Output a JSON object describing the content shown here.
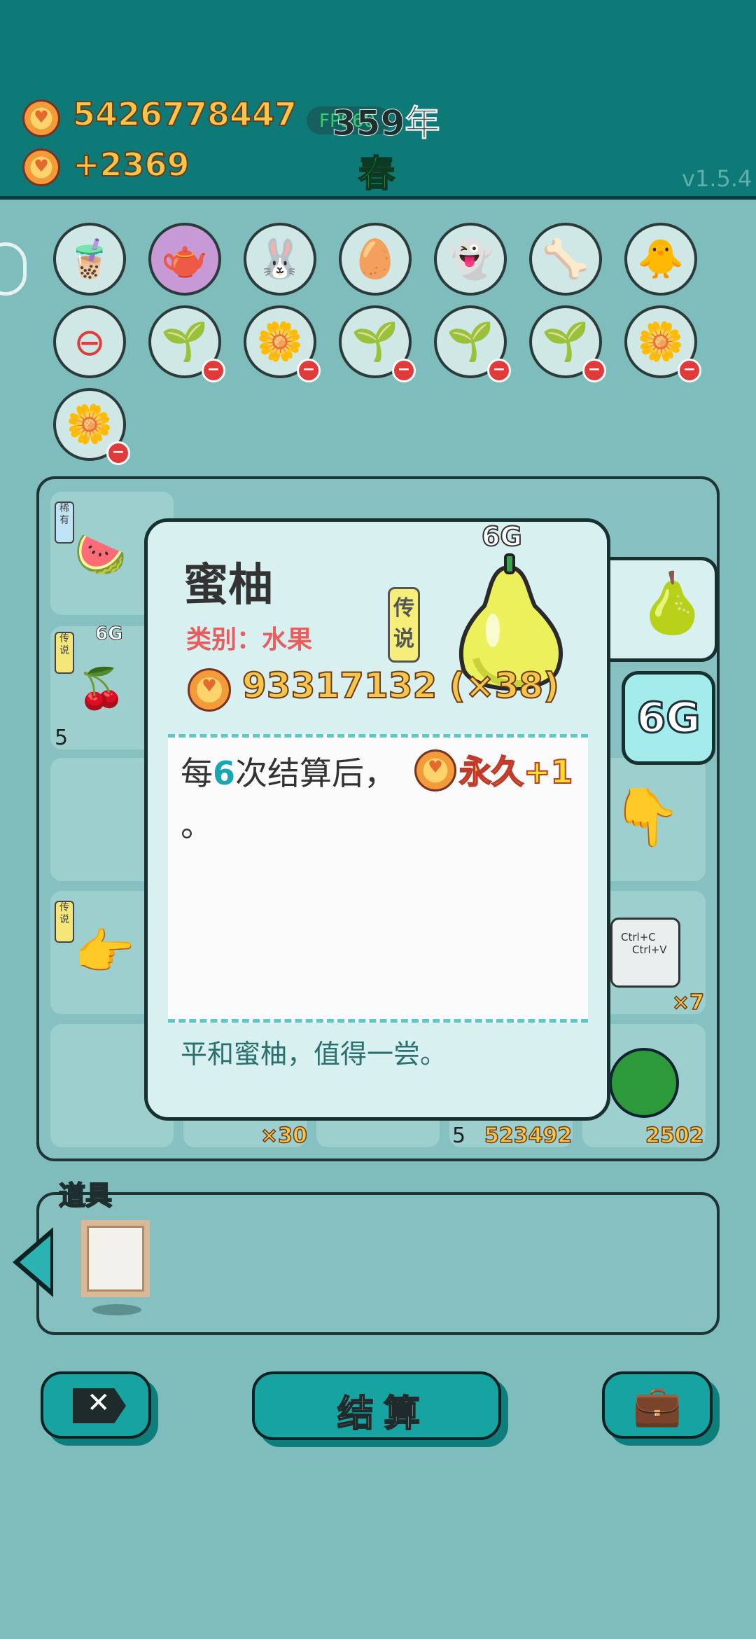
{
  "header": {
    "total_coins": "5426778447",
    "income": "+2369",
    "fps": "FPS60",
    "year": "359年",
    "season": "春",
    "version": "v1.5.4"
  },
  "slots_row1": [
    "🧋",
    "🫖",
    "🐰",
    "🥚",
    "👻",
    "🦴",
    "🐥"
  ],
  "slots_row2": [
    "⊖",
    "🌱",
    "🌼",
    "🌱",
    "🌱",
    "🌱",
    "🌼"
  ],
  "slots_row3": [
    "🌼"
  ],
  "grid": {
    "tags": [
      "稀有",
      "传说",
      "传说"
    ],
    "gen_label": "6G",
    "counts": [
      "5",
      "×30",
      "5",
      "523492",
      "2502",
      "×7"
    ],
    "clipboard": [
      "Ctrl+C",
      "Ctrl+V"
    ]
  },
  "popup": {
    "name": "蜜柚",
    "category": "类别：水果",
    "rarity": "传说",
    "gen": "6G",
    "value": "93317132 (×38)",
    "desc_prefix": "每",
    "desc_num": "6",
    "desc_mid": "次结算后，",
    "desc_bonus": "永久+1",
    "desc_end": "。",
    "flavor": "平和蜜柚，值得一尝。",
    "side_gen": "6G",
    "fruit_icon": "pomelo-icon"
  },
  "items_panel": {
    "title": "道具"
  },
  "buttons": {
    "settle": "结算"
  },
  "colors": {
    "header_bg": "#0e7a78",
    "gold": "#f5c64a",
    "teal_accent": "#16a3a1",
    "rarity_red": "#e85d5d"
  }
}
